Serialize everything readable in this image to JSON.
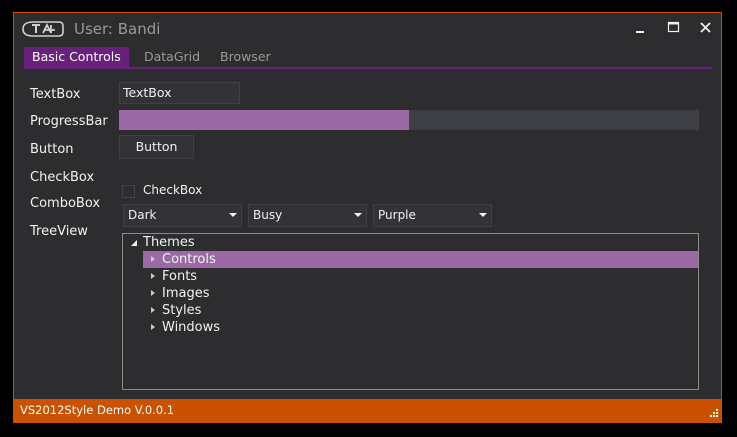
{
  "window": {
    "title": "User: Bandi",
    "logo_icon": "vs-logo-icon",
    "controls": [
      "minimize-icon",
      "maximize-icon",
      "close-icon"
    ],
    "accent": "#68217a",
    "border_color": "#ca5100"
  },
  "tabs": [
    {
      "label": "Basic Controls",
      "active": true
    },
    {
      "label": "DataGrid",
      "active": false
    },
    {
      "label": "Browser",
      "active": false
    }
  ],
  "form": {
    "textbox_label": "TextBox",
    "textbox_value": "TextBox",
    "progress_label": "ProgressBar",
    "progress_value": 0.5,
    "progress_color": "#9b6aa5",
    "button_label": "Button",
    "button_text": "Button",
    "checkbox_label": "CheckBox",
    "checkbox_text": "CheckBox",
    "checkbox_checked": false,
    "combobox_label": "ComboBox",
    "combos": [
      {
        "value": "Dark"
      },
      {
        "value": "Busy"
      },
      {
        "value": "Purple"
      }
    ],
    "treeview_label": "TreeView"
  },
  "tree": {
    "root": "Themes",
    "children": [
      {
        "label": "Controls",
        "selected": true
      },
      {
        "label": "Fonts",
        "selected": false
      },
      {
        "label": "Images",
        "selected": false
      },
      {
        "label": "Styles",
        "selected": false
      },
      {
        "label": "Windows",
        "selected": false
      }
    ]
  },
  "status": {
    "text": "VS2012Style Demo V.0.0.1",
    "color": "#ca5100"
  }
}
